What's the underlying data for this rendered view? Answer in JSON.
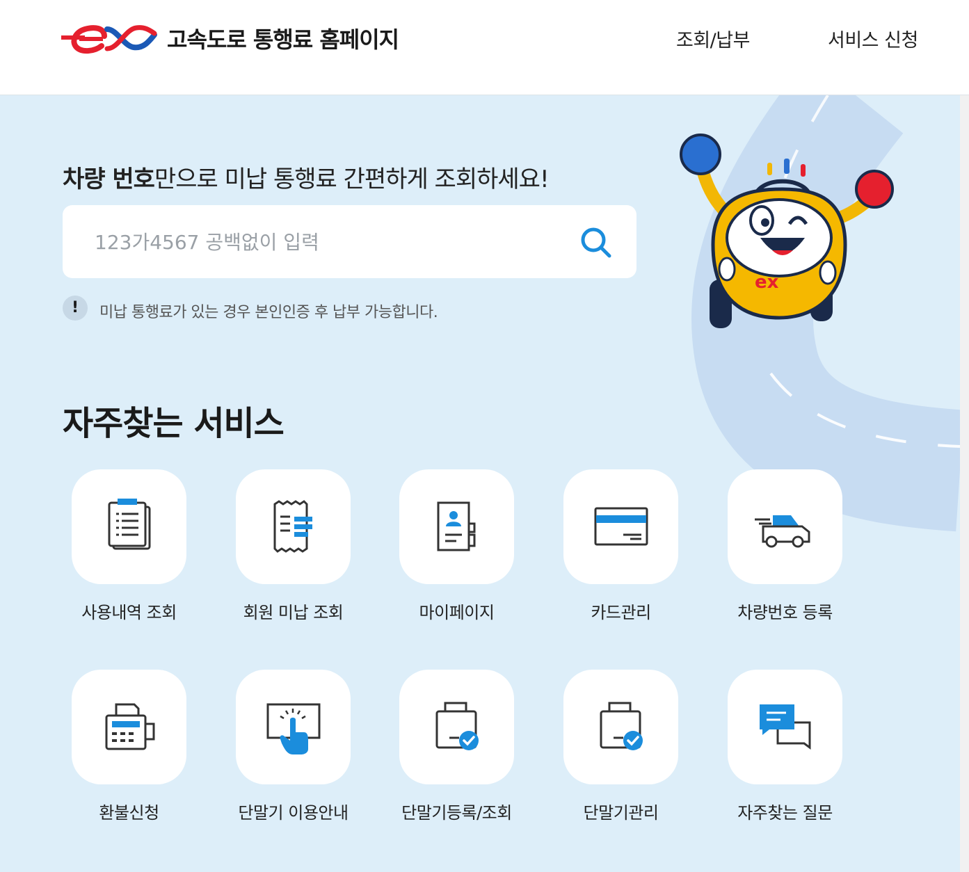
{
  "header": {
    "site_title": "고속도로 통행료 홈페이지",
    "nav": [
      "조회/납부",
      "서비스 신청"
    ]
  },
  "hero": {
    "headline_bold": "차량 번호",
    "headline_rest": "만으로 미납 통행료 간편하게 조회하세요!",
    "search_placeholder": "123가4567 공백없이 입력",
    "notice_mark": "!",
    "notice_text": "미납 통행료가 있는 경우 본인인증 후 납부 가능합니다."
  },
  "services": {
    "title": "자주찾는 서비스",
    "items": [
      {
        "label": "사용내역 조회",
        "icon": "document-list-icon"
      },
      {
        "label": "회원 미납 조회",
        "icon": "receipt-icon"
      },
      {
        "label": "마이페이지",
        "icon": "profile-card-icon"
      },
      {
        "label": "카드관리",
        "icon": "credit-card-icon"
      },
      {
        "label": "차량번호 등록",
        "icon": "car-icon"
      },
      {
        "label": "환불신청",
        "icon": "fax-machine-icon"
      },
      {
        "label": "단말기 이용안내",
        "icon": "touch-screen-icon"
      },
      {
        "label": "단말기등록/조회",
        "icon": "device-check-icon"
      },
      {
        "label": "단말기관리",
        "icon": "device-check-icon"
      },
      {
        "label": "자주찾는 질문",
        "icon": "chat-bubbles-icon"
      }
    ]
  },
  "colors": {
    "brand_red": "#e5202e",
    "brand_blue": "#1b59b6",
    "accent_blue": "#1b8ddc",
    "hero_bg": "#ddeef9"
  }
}
